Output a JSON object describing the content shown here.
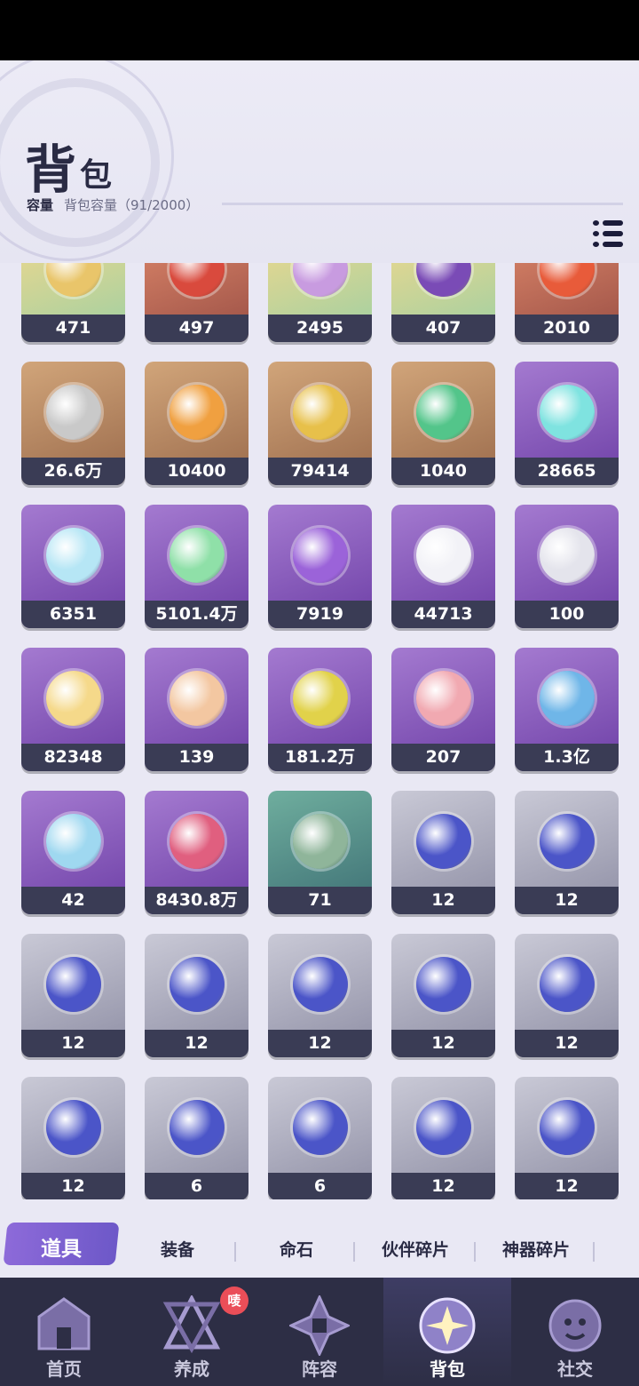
{
  "header": {
    "title_big": "背",
    "title_small": "包",
    "capacity_label": "容量",
    "capacity_text": "背包容量（91/2000）"
  },
  "items": [
    {
      "count": "471",
      "bg": "mix",
      "icon": "gold-emblem-icon",
      "icon_color": "#e9c56a"
    },
    {
      "count": "497",
      "bg": "red",
      "icon": "red-card-icon",
      "icon_color": "#d94a3d"
    },
    {
      "count": "2495",
      "bg": "mix",
      "icon": "rainbow-gem-icon",
      "icon_color": "#c89be0"
    },
    {
      "count": "407",
      "bg": "mix",
      "icon": "purple-crest-icon",
      "icon_color": "#7a4bb6"
    },
    {
      "count": "2010",
      "bg": "red",
      "icon": "red-potion-icon",
      "icon_color": "#e85b3a"
    },
    {
      "count": "26.6万",
      "bg": "brown",
      "icon": "silver-coin-icon",
      "icon_color": "#c9c9c9"
    },
    {
      "count": "10400",
      "bg": "brown",
      "icon": "orange-potion-icon",
      "icon_color": "#f0a040"
    },
    {
      "count": "79414",
      "bg": "brown",
      "icon": "gold-ore-icon",
      "icon_color": "#e7c04a"
    },
    {
      "count": "1040",
      "bg": "brown",
      "icon": "green-upgrade-icon",
      "icon_color": "#53c58a"
    },
    {
      "count": "28665",
      "bg": "purple",
      "icon": "crystal-shard-icon",
      "icon_color": "#7fe3e0"
    },
    {
      "count": "6351",
      "bg": "purple",
      "icon": "prism-star-icon",
      "icon_color": "#b6e6f5"
    },
    {
      "count": "5101.4万",
      "bg": "purple",
      "icon": "roman-three-coin-icon",
      "icon_color": "#8fe0a8"
    },
    {
      "count": "7919",
      "bg": "purple",
      "icon": "purple-potion-icon",
      "icon_color": "#9b63d9"
    },
    {
      "count": "44713",
      "bg": "purple",
      "icon": "white-powder-icon",
      "icon_color": "#f2f2f7"
    },
    {
      "count": "100",
      "bg": "purple",
      "icon": "token-20-icon",
      "icon_color": "#e4e4ec"
    },
    {
      "count": "82348",
      "bg": "purple",
      "icon": "cloud-orb-icon",
      "icon_color": "#f5d98a"
    },
    {
      "count": "139",
      "bg": "purple",
      "icon": "star-medal-icon",
      "icon_color": "#f3c7a1"
    },
    {
      "count": "181.2万",
      "bg": "purple",
      "icon": "sword-medal-icon",
      "icon_color": "#e1d24a"
    },
    {
      "count": "207",
      "bg": "purple",
      "icon": "pink-upgrade-icon",
      "icon_color": "#f1a9b1"
    },
    {
      "count": "1.3亿",
      "bg": "purple",
      "icon": "helmet-orb-icon",
      "icon_color": "#6fb6e8"
    },
    {
      "count": "42",
      "bg": "purple",
      "icon": "rainbow-crystal-icon",
      "icon_color": "#9fd8f0"
    },
    {
      "count": "8430.8万",
      "bg": "purple",
      "icon": "pink-creature-orb-icon",
      "icon_color": "#e05f7f"
    },
    {
      "count": "71",
      "bg": "teal",
      "icon": "green-card-icon",
      "icon_color": "#8fb59a"
    },
    {
      "count": "12",
      "bg": "gray",
      "icon": "shield-swap-orb-icon",
      "icon_color": "#4b55c8"
    },
    {
      "count": "12",
      "bg": "gray",
      "icon": "arrow-swap-orb-icon",
      "icon_color": "#4b55c8"
    },
    {
      "count": "12",
      "bg": "gray",
      "icon": "guard-swap-orb-icon",
      "icon_color": "#4b55c8"
    },
    {
      "count": "12",
      "bg": "gray",
      "icon": "cat-swap-orb-icon",
      "icon_color": "#4b55c8"
    },
    {
      "count": "12",
      "bg": "gray",
      "icon": "refresh-swap-orb-icon",
      "icon_color": "#4b55c8"
    },
    {
      "count": "12",
      "bg": "gray",
      "icon": "wave-swap-orb-icon",
      "icon_color": "#4b55c8"
    },
    {
      "count": "12",
      "bg": "gray",
      "icon": "dash-swap-orb-icon",
      "icon_color": "#4b55c8"
    },
    {
      "count": "12",
      "bg": "gray",
      "icon": "snowflake-swap-orb-icon",
      "icon_color": "#4b55c8"
    },
    {
      "count": "6",
      "bg": "gray",
      "icon": "cross-swap-orb-icon",
      "icon_color": "#4b55c8"
    },
    {
      "count": "6",
      "bg": "gray",
      "icon": "upload-swap-orb-icon",
      "icon_color": "#4b55c8"
    },
    {
      "count": "12",
      "bg": "gray",
      "icon": "droplet-swap-orb-icon",
      "icon_color": "#4b55c8"
    },
    {
      "count": "12",
      "bg": "gray",
      "icon": "skull-swap-orb-icon",
      "icon_color": "#4b55c8"
    }
  ],
  "tabs": [
    {
      "label": "道具",
      "active": true
    },
    {
      "label": "装备"
    },
    {
      "label": "命石"
    },
    {
      "label": "伙伴碎片"
    },
    {
      "label": "神器碎片"
    }
  ],
  "nav": [
    {
      "label": "首页",
      "icon": "home-icon"
    },
    {
      "label": "养成",
      "icon": "growth-icon"
    },
    {
      "label": "阵容",
      "icon": "lineup-icon"
    },
    {
      "label": "背包",
      "icon": "backpack-icon",
      "active": true
    },
    {
      "label": "社交",
      "icon": "social-icon"
    }
  ],
  "badge": "唛"
}
